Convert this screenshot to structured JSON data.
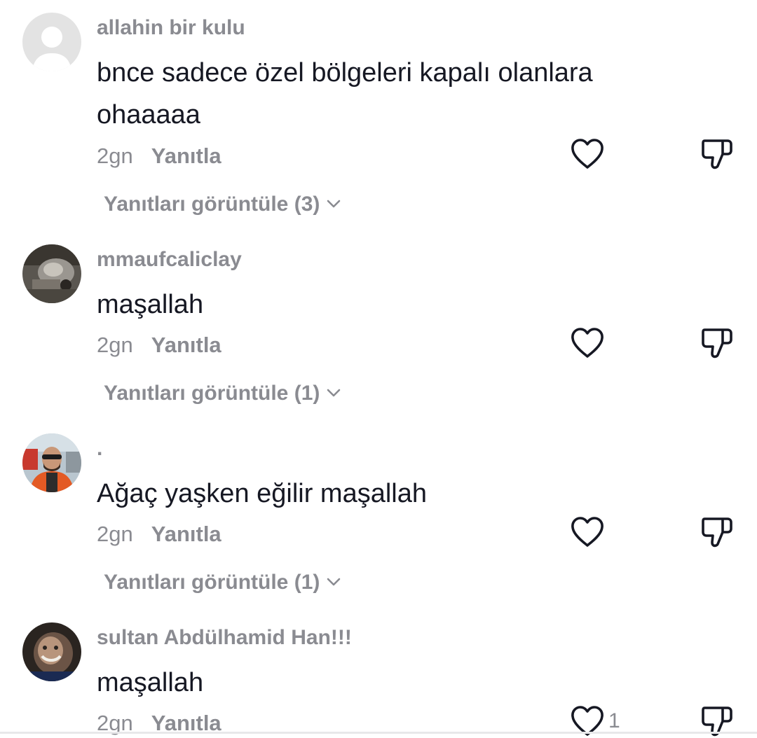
{
  "comments": [
    {
      "username": "allahin bir kulu",
      "text_line1": "bnce sadece özel bölgeleri kapalı olanlara",
      "text_line2": "ohaaaaa",
      "time": "2gn",
      "reply_label": "Yanıtla",
      "view_replies": "Yanıtları görüntüle (3)",
      "avatar_icon": "default-avatar-icon"
    },
    {
      "username": "mmaufcaliclay",
      "text_line1": "maşallah",
      "time": "2gn",
      "reply_label": "Yanıtla",
      "view_replies": "Yanıtları görüntüle (1)",
      "avatar_icon": "user-photo-avatar"
    },
    {
      "username": ".",
      "text_line1": "Ağaç yaşken eğilir maşallah",
      "time": "2gn",
      "reply_label": "Yanıtla",
      "view_replies": "Yanıtları görüntüle (1)",
      "avatar_icon": "user-photo-avatar"
    },
    {
      "username": "sultan Abdülhamid Han!!!",
      "text_line1": "maşallah",
      "time": "2gn",
      "reply_label": "Yanıtla",
      "like_count": "1",
      "avatar_icon": "user-photo-avatar"
    }
  ],
  "icons": {
    "like": "heart-outline-icon",
    "dislike": "thumbs-down-outline-icon",
    "expand": "chevron-down-icon"
  },
  "colors": {
    "primary_text": "#161823",
    "secondary_text": "#8a8b91",
    "icon": "#161823",
    "default_avatar_bg": "#e3e3e3"
  }
}
